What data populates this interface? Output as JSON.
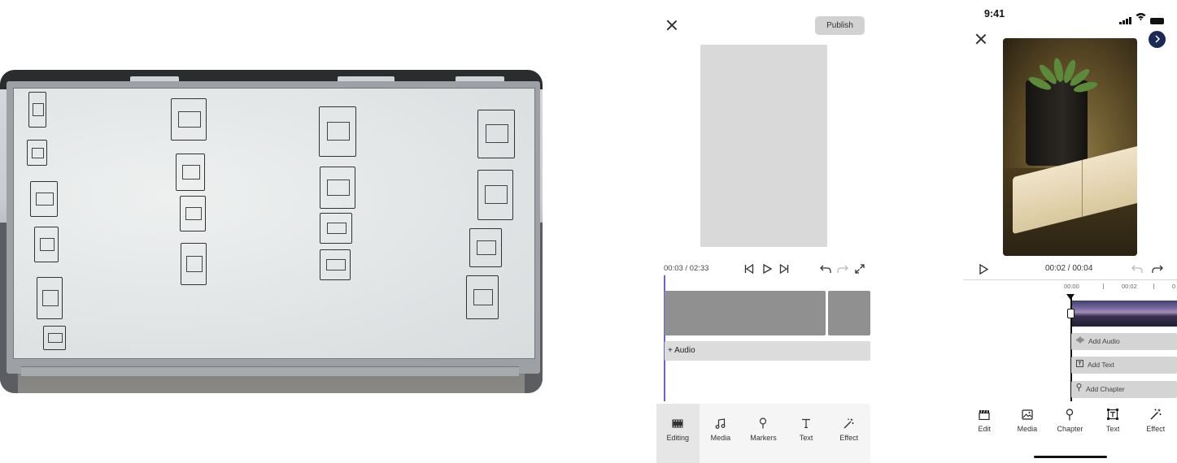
{
  "wireframe": {
    "publish_label": "Publish",
    "timecode": "00:03 / 02:33",
    "audio_label": "+ Audio",
    "tabs": [
      {
        "label": "Editing",
        "icon": "film-strip-icon",
        "active": true
      },
      {
        "label": "Media",
        "icon": "music-note-icon",
        "active": false
      },
      {
        "label": "Markers",
        "icon": "map-pin-icon",
        "active": false
      },
      {
        "label": "Text",
        "icon": "text-t-icon",
        "active": false
      },
      {
        "label": "Effect",
        "icon": "magic-wand-icon",
        "active": false
      }
    ]
  },
  "mobile": {
    "status_time": "9:41",
    "timecode": "00:02 / 00:04",
    "ruler": [
      "00:00",
      "00:02",
      "0"
    ],
    "tracks": [
      {
        "label": "Add Audio",
        "icon": "waveform-icon"
      },
      {
        "label": "Add Text",
        "icon": "text-box-icon"
      },
      {
        "label": "Add Chapter",
        "icon": "pin-icon"
      }
    ],
    "tabs": [
      {
        "label": "Edit",
        "icon": "clapperboard-icon"
      },
      {
        "label": "Media",
        "icon": "image-icon"
      },
      {
        "label": "Chapter",
        "icon": "pin-icon"
      },
      {
        "label": "Text",
        "icon": "text-box-icon"
      },
      {
        "label": "Effect",
        "icon": "magic-wand-icon"
      }
    ]
  }
}
